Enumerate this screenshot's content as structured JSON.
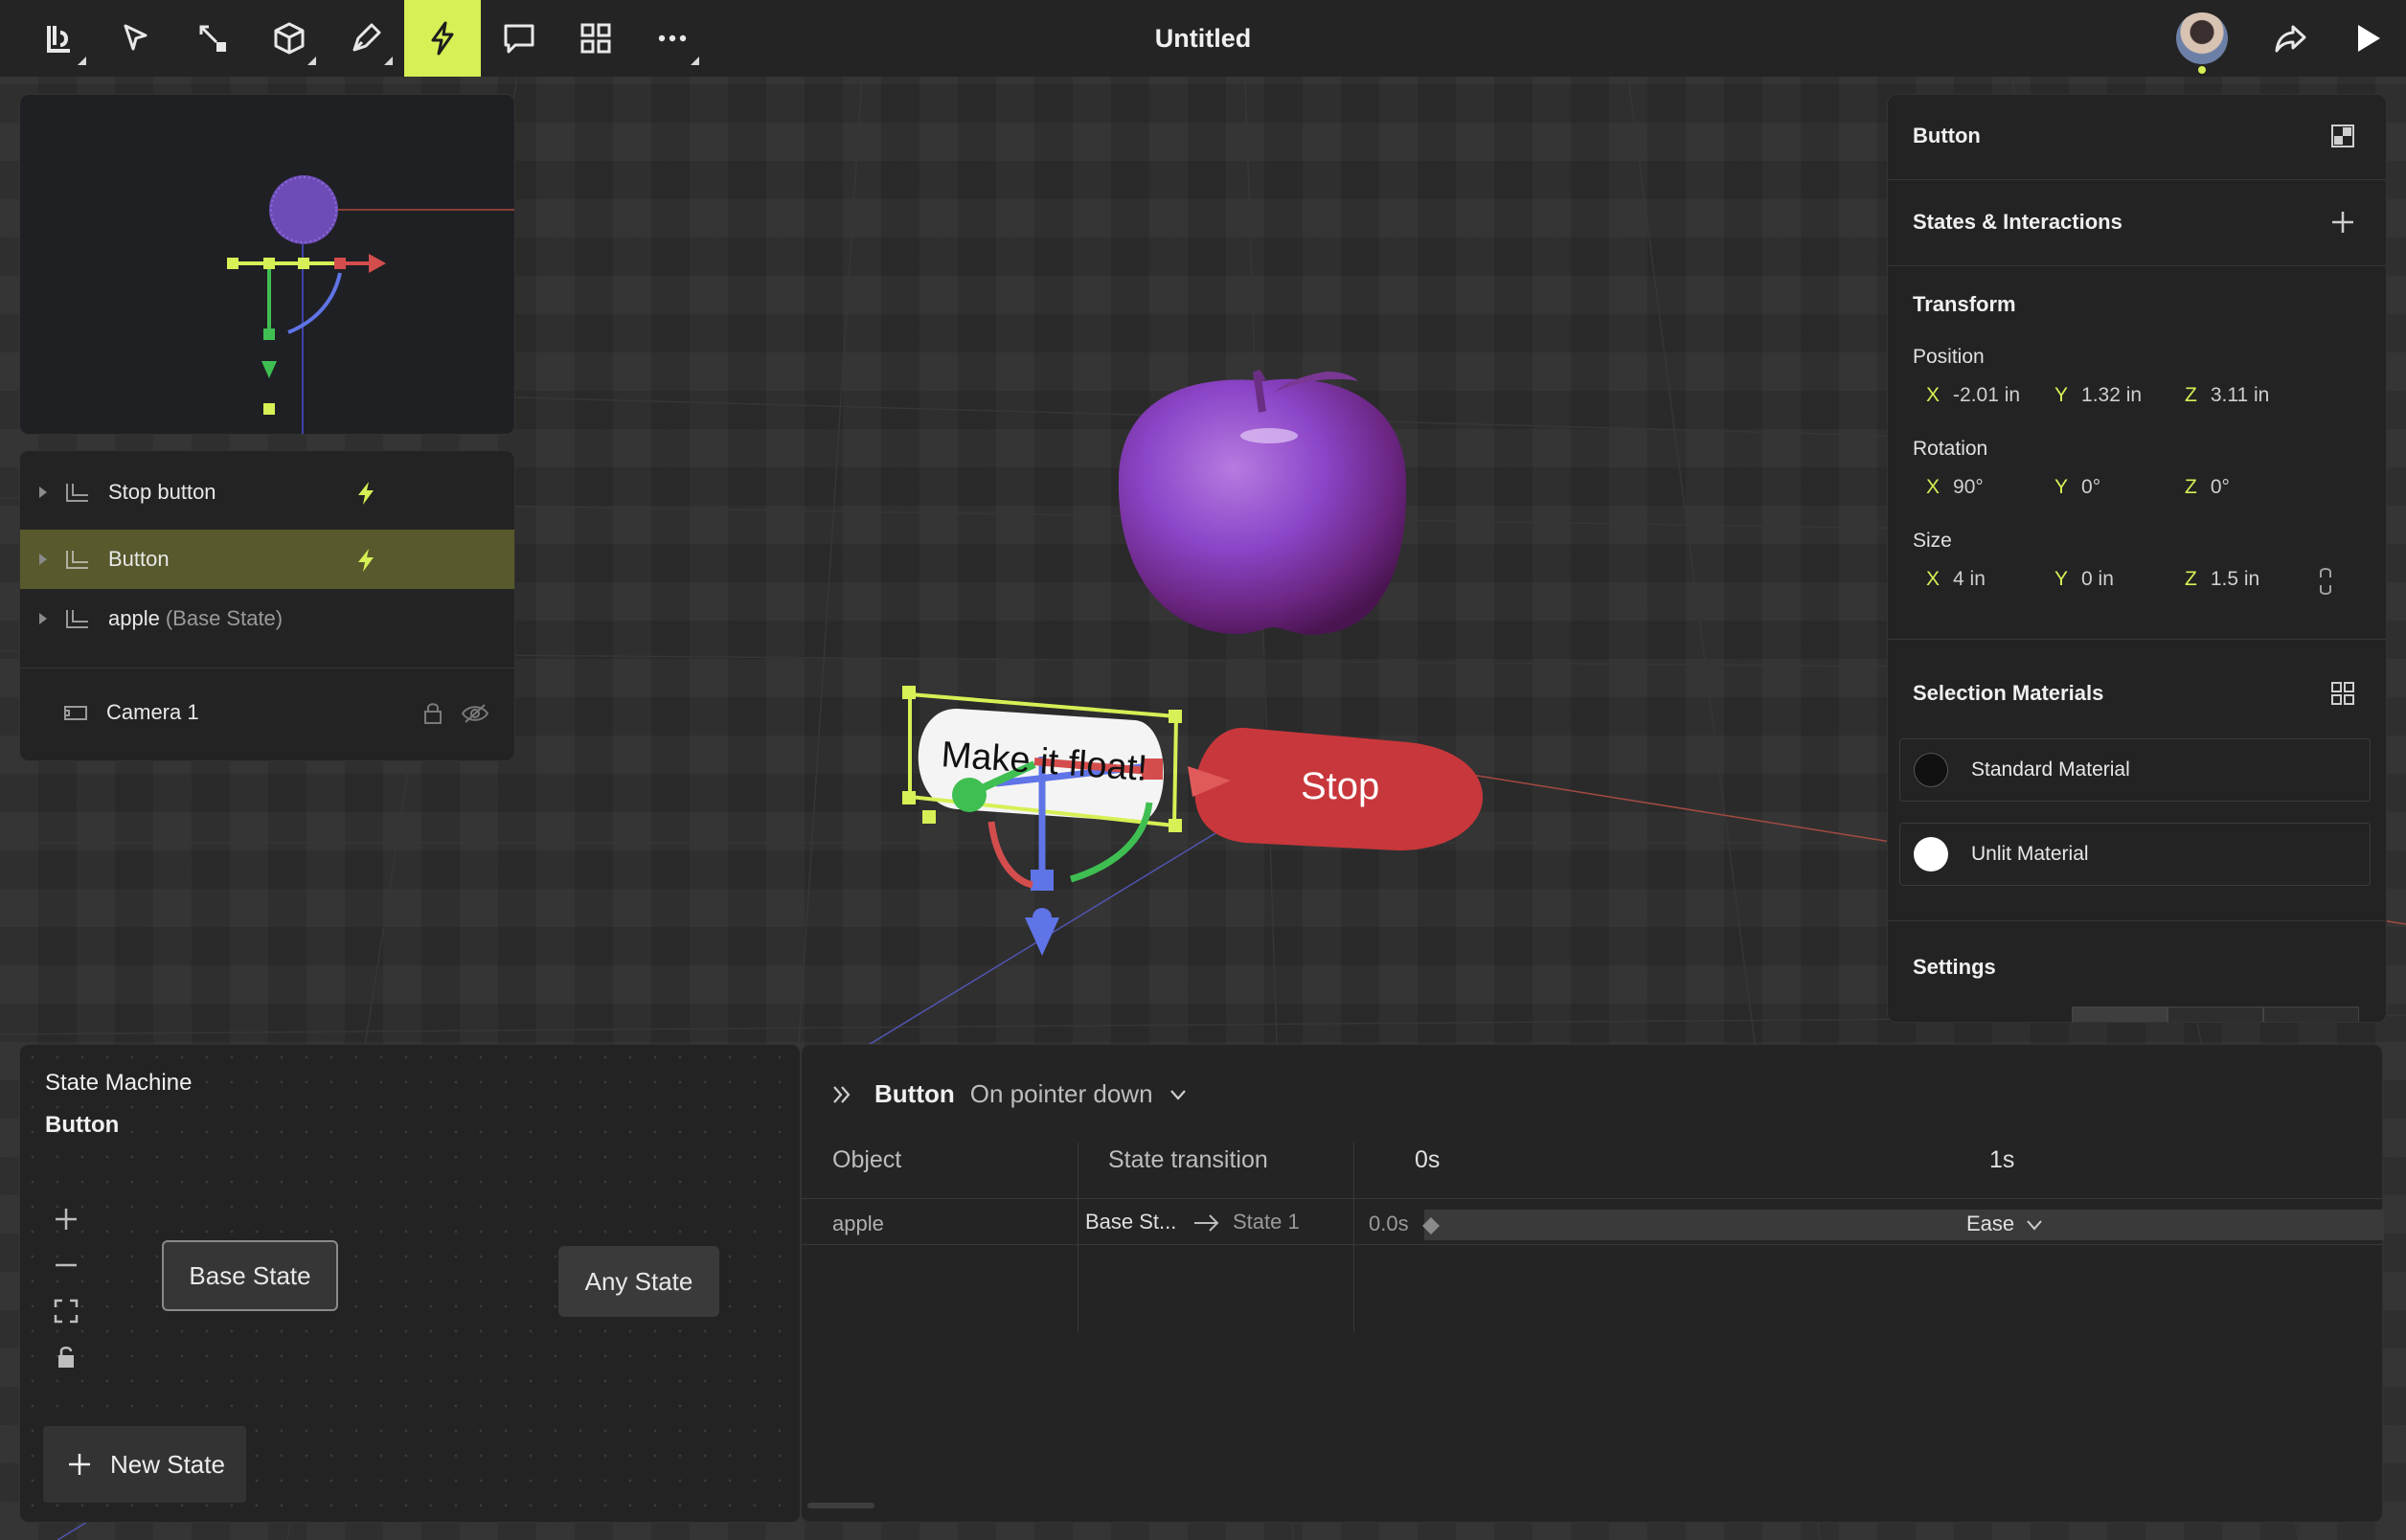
{
  "app": {
    "document_title": "Untitled"
  },
  "toolbar": {
    "tools": [
      {
        "name": "logo-menu-icon",
        "active": false
      },
      {
        "name": "select-pointer-icon",
        "active": false
      },
      {
        "name": "scale-icon",
        "active": false
      },
      {
        "name": "cube-icon",
        "active": false
      },
      {
        "name": "pen-icon",
        "active": false
      },
      {
        "name": "lightning-icon",
        "active": true
      },
      {
        "name": "comment-icon",
        "active": false
      },
      {
        "name": "grid-icon",
        "active": false
      },
      {
        "name": "more-icon",
        "active": false
      }
    ],
    "accent_color": "#d6f055"
  },
  "scene": {
    "button_text": "Make it float!",
    "stop_text": "Stop"
  },
  "layers": {
    "items": [
      {
        "label": "Stop button",
        "suffix": "",
        "selected": false,
        "has_interaction": true
      },
      {
        "label": "Button",
        "suffix": "",
        "selected": true,
        "has_interaction": true
      },
      {
        "label": "apple",
        "suffix": "(Base State)",
        "selected": false,
        "has_interaction": false
      }
    ],
    "camera": {
      "label": "Camera 1"
    }
  },
  "inspector": {
    "object_name": "Button",
    "states_title": "States & Interactions",
    "transform_title": "Transform",
    "position": {
      "label": "Position",
      "x": "-2.01 in",
      "y": "1.32 in",
      "z": "3.11 in"
    },
    "rotation": {
      "label": "Rotation",
      "x": "90°",
      "y": "0°",
      "z": "0°"
    },
    "size": {
      "label": "Size",
      "x": "4 in",
      "y": "0 in",
      "z": "1.5 in"
    },
    "axis_labels": {
      "x": "X",
      "y": "Y",
      "z": "Z"
    },
    "materials_title": "Selection Materials",
    "materials": [
      {
        "label": "Standard Material",
        "swatch": "#111111"
      },
      {
        "label": "Unlit Material",
        "swatch": "#ffffff"
      }
    ],
    "settings_title": "Settings"
  },
  "state_machine": {
    "title": "State Machine",
    "object": "Button",
    "states": [
      "Base State",
      "Any State"
    ],
    "new_state_label": "New State"
  },
  "timeline": {
    "object": "Button",
    "event": "On pointer down",
    "columns": {
      "object": "Object",
      "transition": "State transition",
      "t0": "0s",
      "t1": "1s"
    },
    "rows": [
      {
        "object": "apple",
        "from": "Base St...",
        "to": "State 1",
        "delay": "0.0s",
        "easing": "Ease"
      }
    ]
  }
}
